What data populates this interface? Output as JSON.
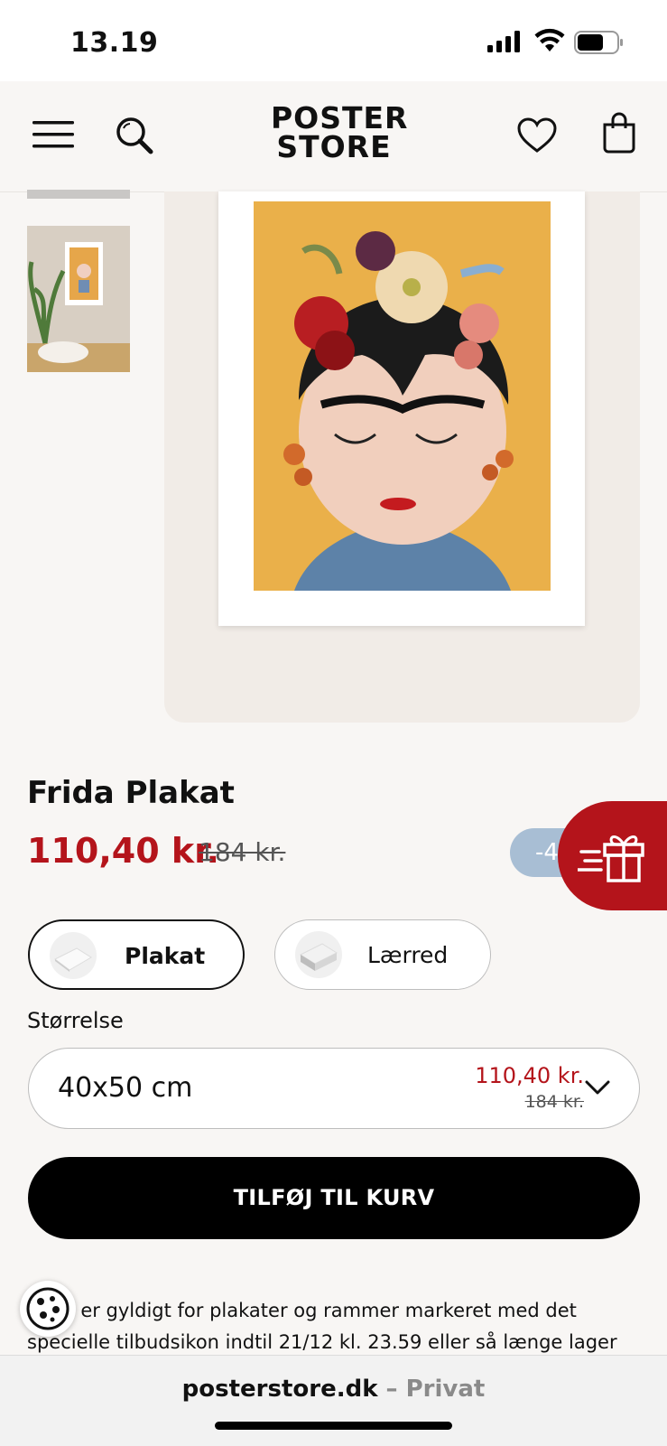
{
  "status_bar": {
    "time": "13.19"
  },
  "header": {
    "logo_line1": "POSTER",
    "logo_line2": "STORE",
    "menu_icon": "hamburger-icon",
    "search_icon": "search-icon",
    "wishlist_icon": "heart-icon",
    "cart_icon": "bag-icon"
  },
  "product": {
    "title": "Frida Plakat",
    "price": "110,40 kr.",
    "old_price": "184 kr.",
    "discount": "-4"
  },
  "format_options": [
    {
      "label": "Plakat",
      "selected": true
    },
    {
      "label": "Lærred",
      "selected": false
    }
  ],
  "size": {
    "label": "Størrelse",
    "value": "40x50 cm",
    "price": "110,40 kr.",
    "old_price": "184 kr."
  },
  "add_to_cart": {
    "label": "TILFØJ TIL KURV"
  },
  "description": {
    "line1": "ud er gyldigt for plakater og rammer markeret med det",
    "line2": "specielle tilbudsikon indtil 21/12 kl. 23.59 eller så længe lager"
  },
  "browser": {
    "domain": "posterstore.dk",
    "mode": " – Privat"
  },
  "colors": {
    "accent_red": "#b4141b",
    "discount_blue": "#a8bed4",
    "background": "#f8f6f4"
  }
}
